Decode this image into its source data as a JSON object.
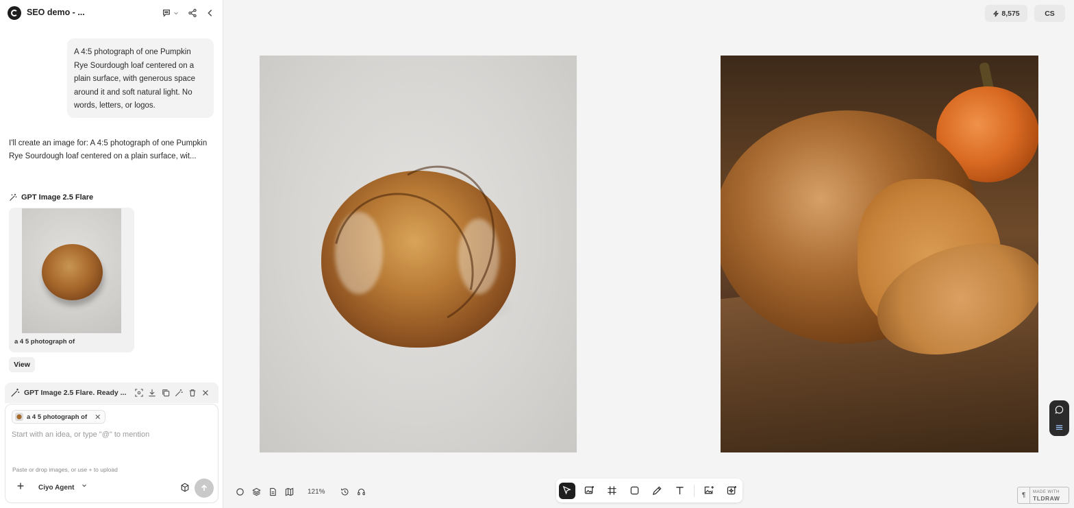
{
  "sidebar": {
    "project_title": "SEO demo - ...",
    "user_message": "A 4:5 photograph of one Pumpkin Rye Sourdough loaf centered on a plain surface, with generous space around it and soft natural light. No words, letters, or logos.",
    "assistant_message": "I'll create an image for: A 4:5 photograph of one Pumpkin Rye Sourdough loaf centered on a plain surface, wit...",
    "model_name": "GPT Image 2.5 Flare",
    "thumb_caption": "a 4 5 photograph of",
    "view_label": "View",
    "status_text": "GPT Image 2.5 Flare. Ready ...",
    "composer": {
      "chip_label": "a 4 5 photograph of",
      "placeholder": "Start with an idea, or type \"@\" to mention",
      "hint": "Paste or drop images, or use + to upload",
      "agent_label": "Ciyo Agent"
    }
  },
  "canvas": {
    "credits": "8,575",
    "avatar_initials": "CS",
    "zoom": "121%",
    "badge_small": "MADE WITH",
    "badge_big": "TLDRAW"
  },
  "icons": {
    "header": [
      "comment-icon",
      "share-icon",
      "collapse-icon"
    ],
    "toolbar": [
      "select-icon",
      "image-gen-icon",
      "frame-icon",
      "rectangle-icon",
      "pencil-icon",
      "text-icon",
      "image-upload-icon",
      "ai-image-icon"
    ]
  }
}
